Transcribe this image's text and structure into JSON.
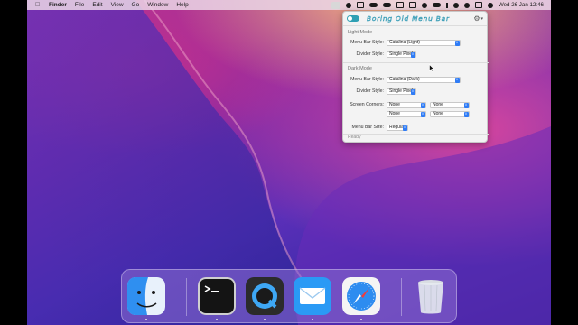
{
  "menubar": {
    "apple_icon": "apple-icon",
    "app_name": "Finder",
    "items": [
      "File",
      "Edit",
      "View",
      "Go",
      "Window",
      "Help"
    ],
    "clock": "Wed 26 Jan  12:46"
  },
  "panel": {
    "logo": "Boring Old Menu Bar",
    "toggle_on": true,
    "light_mode": {
      "title": "Light Mode",
      "menu_bar_style_label": "Menu Bar Style:",
      "menu_bar_style_value": "Catalina (Light)",
      "divider_style_label": "Divider Style:",
      "divider_style_value": "Single Pixel"
    },
    "dark_mode": {
      "title": "Dark Mode",
      "menu_bar_style_label": "Menu Bar Style:",
      "menu_bar_style_value": "Catalina (Dark)",
      "divider_style_label": "Divider Style:",
      "divider_style_value": "Single Pixel"
    },
    "screen_corners": {
      "label": "Screen Corners:",
      "values": [
        "None",
        "None",
        "None",
        "None"
      ]
    },
    "menu_bar_size": {
      "label": "Menu Bar Size:",
      "value": "Regular"
    },
    "status": "Ready"
  },
  "dock": {
    "apps": [
      "Finder",
      "Terminal",
      "QuickTime Player",
      "Mail",
      "Safari",
      "Trash"
    ]
  },
  "colors": {
    "accent_teal": "#2fa0b4",
    "stepper_blue": "#2f7cf6"
  }
}
